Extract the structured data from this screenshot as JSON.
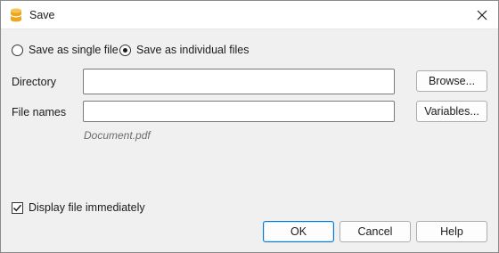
{
  "window": {
    "title": "Save",
    "app_icon": "database-cylinder-icon",
    "close_icon": "close-icon"
  },
  "save_mode": {
    "options": [
      {
        "label": "Save as single file",
        "selected": false
      },
      {
        "label": "Save as individual files",
        "selected": true
      }
    ]
  },
  "form": {
    "directory_label": "Directory",
    "directory_value": "",
    "browse_label": "Browse...",
    "filenames_label": "File names",
    "filenames_value": "",
    "variables_label": "Variables...",
    "filename_hint": "Document.pdf"
  },
  "display_immediately": {
    "label": "Display file immediately",
    "checked": true
  },
  "footer": {
    "ok_label": "OK",
    "cancel_label": "Cancel",
    "help_label": "Help"
  },
  "colors": {
    "accent": "#0078d7",
    "icon_yellow": "#f2b632"
  }
}
